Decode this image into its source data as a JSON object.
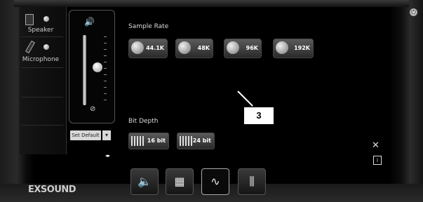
{
  "devices": {
    "speaker_label": "Speaker",
    "microphone_label": "Microphone"
  },
  "volume": {
    "set_default_label": "Set Default",
    "dropdown_glyph": "▾",
    "arrows_glyph": "◂▸"
  },
  "sample_rate": {
    "title": "Sample Rate",
    "options": [
      "44.1K",
      "48K",
      "96K",
      "192K"
    ]
  },
  "bit_depth": {
    "title": "Bit Depth",
    "options": [
      "16 bit",
      "24 bit"
    ]
  },
  "callout_label": "3",
  "brand": "EXSOUND",
  "tabs": [
    {
      "icon": "speaker-config-icon",
      "glyph": "🔈"
    },
    {
      "icon": "grid-mixer-icon",
      "glyph": "▦"
    },
    {
      "icon": "waveform-icon",
      "glyph": "∿"
    },
    {
      "icon": "equalizer-icon",
      "glyph": "⫼"
    }
  ],
  "side_icons": {
    "tools_glyph": "✕",
    "info_glyph": "i",
    "power_glyph": "⏻"
  }
}
